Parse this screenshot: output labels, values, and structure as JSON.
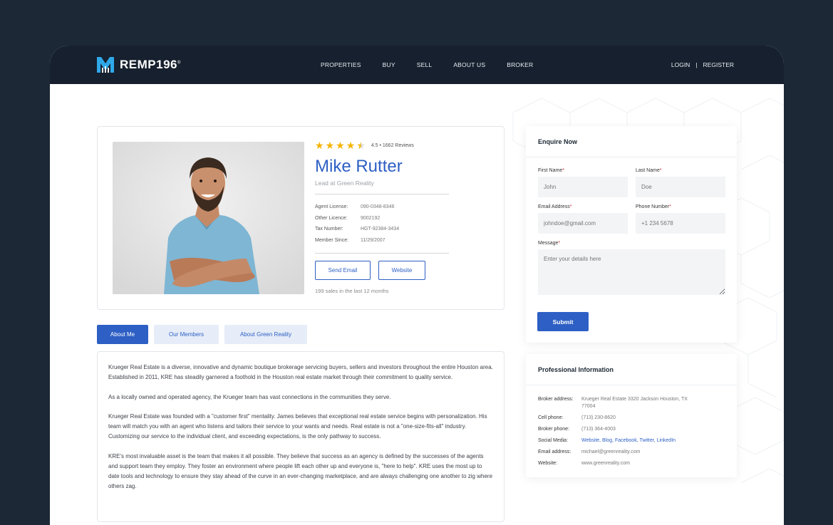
{
  "brand": {
    "name": "REMP196",
    "reg": "®"
  },
  "nav": {
    "links": [
      "PROPERTIES",
      "BUY",
      "SELL",
      "ABOUT US",
      "BROKER"
    ],
    "login": "LOGIN",
    "separator": "|",
    "register": "REGISTER"
  },
  "agent": {
    "rating_text": "4.5 • 1662 Reviews",
    "rating": 4.5,
    "name": "Mike Rutter",
    "role": "Lead at Green Reality",
    "details": [
      {
        "label": "Agent License:",
        "value": "090-0348-8346"
      },
      {
        "label": "Other Licence:",
        "value": "9002192"
      },
      {
        "label": "Tax Number:",
        "value": "HGT-92384-3434"
      },
      {
        "label": "Member Since:",
        "value": "11/29/2007"
      }
    ],
    "send_email": "Send Email",
    "website": "Website",
    "sales_text": "199 sales in the last 12 months"
  },
  "tabs": [
    "About Me",
    "Our Members",
    "About Green Reality"
  ],
  "about": [
    "Krueger Real Estate is a diverse, innovative and dynamic boutique brokerage servicing buyers, sellers and investors throughout the entire Houston area. Established in 2011, KRE has steadily garnered a foothold in the Houston real estate market through their commitment to quality service.",
    "As a locally owned and operated agency, the Krueger team has vast connections in the communities they serve.",
    "Krueger Real Estate was founded with a \"customer first\" mentality. James believes that exceptional real estate service begins with personalization. His team will match you with an agent who listens and tailors their service to your wants and needs. Real estate is not a \"one-size-fits-all\" industry. Customizing our service to the individual client, and exceeding expectations, is the only pathway to success.",
    "KRE's most invaluable asset is the team that makes it all possible. They believe that success as an agency is defined by the successes of the agents and support team they employ. They foster an environment where people lift each other up and everyone is, \"here to help\". KRE uses the most up to date tools and technology to ensure they stay ahead of the curve in an ever-changing marketplace, and are always challenging one another to zig where others zag."
  ],
  "enquire": {
    "title": "Enquire Now",
    "first_name_label": "First Name",
    "first_name_placeholder": "John",
    "last_name_label": "Last Name",
    "last_name_placeholder": "Doe",
    "email_label": "Email Address",
    "email_placeholder": "johndoe@gmail.com",
    "phone_label": "Phone Number",
    "phone_placeholder": "+1 234 5678",
    "message_label": "Message",
    "message_placeholder": "Enter your details here",
    "required_mark": "*",
    "submit": "Submit"
  },
  "professional": {
    "title": "Professional Information",
    "rows": [
      {
        "label": "Broker address:",
        "value": "Krueger Real Estate 3320 Jackson Houston, TX 77004"
      },
      {
        "label": "Cell phone:",
        "value": "(713) 230-8620"
      },
      {
        "label": "Broker phone:",
        "value": "(713) 364-4003"
      },
      {
        "label": "Social Media:",
        "value": "Website, Blog, Facebook, Twitter, LinkedIn"
      },
      {
        "label": "Email address:",
        "value": "michael@greenreality.com"
      },
      {
        "label": "Website:",
        "value": "www.greenreality.com"
      }
    ]
  },
  "colors": {
    "accent": "#2d5fc4",
    "nav_bg": "#16202e",
    "page_bg": "#1c2836",
    "star": "#f5b400"
  }
}
